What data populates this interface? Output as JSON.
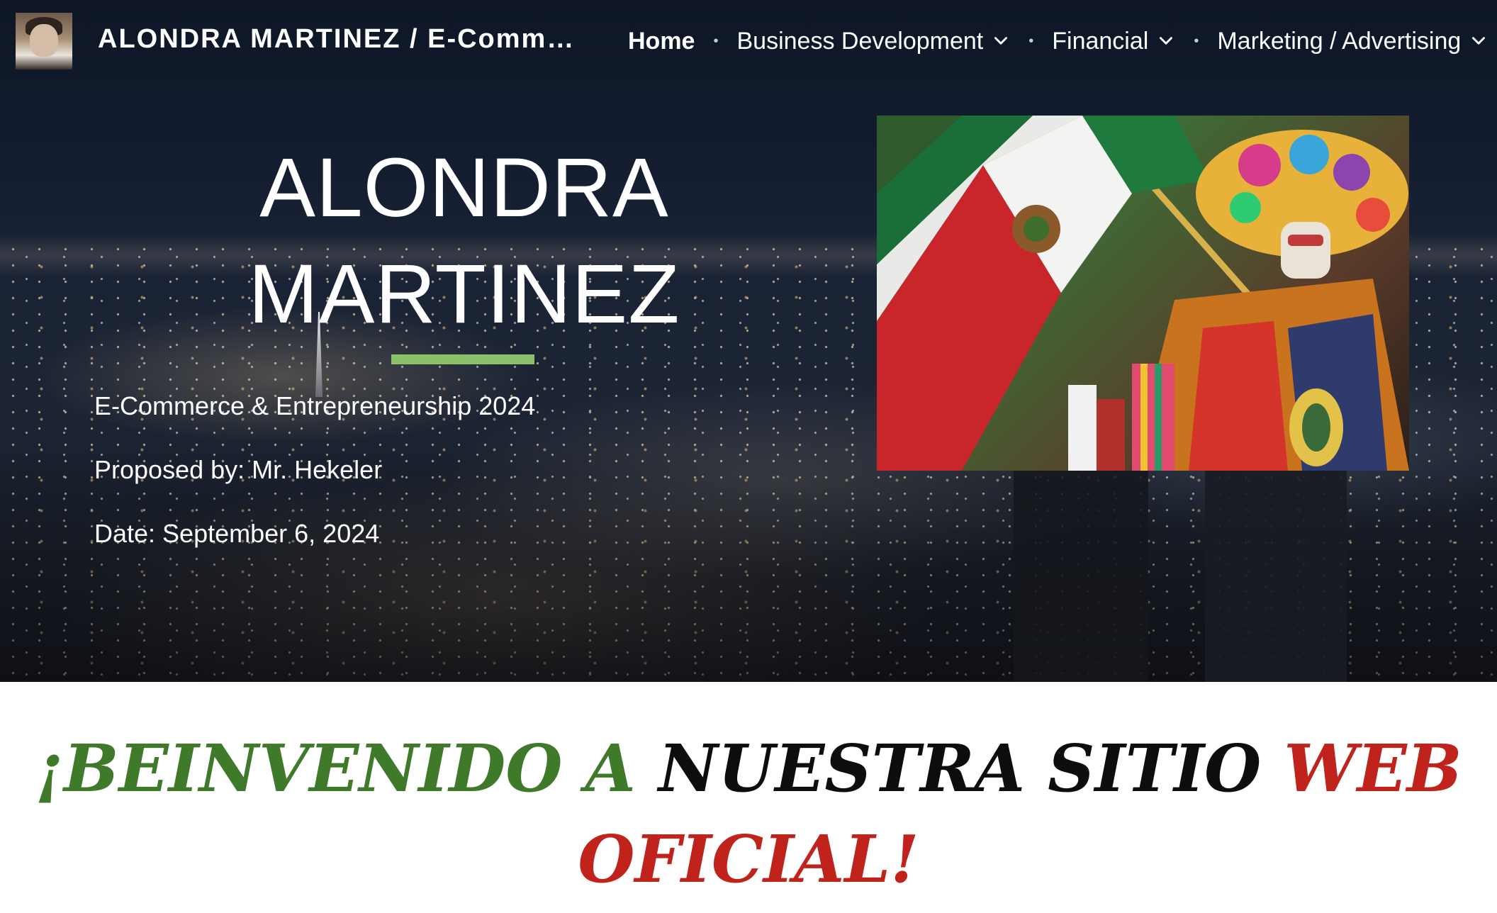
{
  "header": {
    "site_title": "ALONDRA MARTINEZ / E-Comm…",
    "avatar_icon": "profile-portrait-icon",
    "nav": [
      {
        "label": "Home",
        "active": true,
        "has_dropdown": false
      },
      {
        "label": "Business Development",
        "active": false,
        "has_dropdown": true
      },
      {
        "label": "Financial",
        "active": false,
        "has_dropdown": true
      },
      {
        "label": "Marketing / Advertising",
        "active": false,
        "has_dropdown": true
      }
    ]
  },
  "hero": {
    "title_line1": "ALONDRA",
    "title_line2": "MARTINEZ",
    "subtitle": "E-Commerce & Entrepreneurship 2024",
    "proposed_by": "Proposed by: Mr. Hekeler",
    "date": "Date: September 6, 2024",
    "accent_color": "#8bc16a"
  },
  "welcome": {
    "part1": "¡BEINVENIDO A",
    "part2": "NUESTRA SITIO",
    "part3": "WEB OFICIAL!",
    "colors": {
      "green": "#3f7a2a",
      "black": "#0d0d0d",
      "red": "#c0231c"
    }
  }
}
